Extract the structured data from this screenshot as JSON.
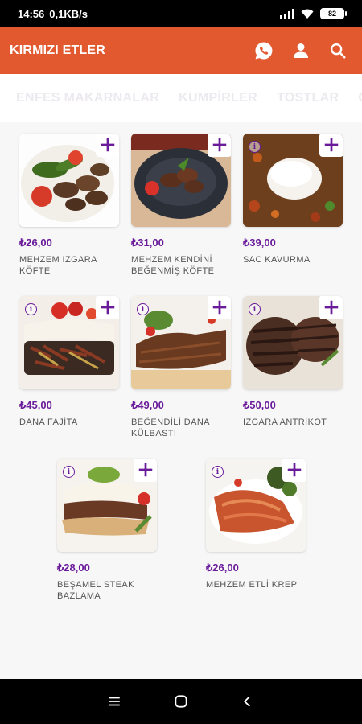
{
  "status_bar": {
    "time": "14:56",
    "network_speed": "0,1KB/s",
    "battery": "82"
  },
  "app_bar": {
    "title": "KIRMIZI ETLER",
    "icons": [
      "whatsapp-icon",
      "user-icon",
      "search-icon"
    ],
    "color": "#e2582f"
  },
  "tabs": [
    {
      "label": "ENFES MAKARNALAR"
    },
    {
      "label": "KUMPİRLER"
    },
    {
      "label": "TOSTLAR"
    },
    {
      "label": "GÖ"
    }
  ],
  "accent_color": "#6a1b9a",
  "products": [
    {
      "price": "₺26,00",
      "name": "MEHZEM IZGARA KÖFTE",
      "has_info": false
    },
    {
      "price": "₺31,00",
      "name": "MEHZEM KENDİNİ BEĞENMİŞ KÖFTE",
      "has_info": false
    },
    {
      "price": "₺39,00",
      "name": "SAC KAVURMA",
      "has_info": true
    },
    {
      "price": "₺45,00",
      "name": "DANA FAJİTA",
      "has_info": true
    },
    {
      "price": "₺49,00",
      "name": "BEĞENDİLİ DANA KÜLBASTI",
      "has_info": true
    },
    {
      "price": "₺50,00",
      "name": "IZGARA ANTRİKOT",
      "has_info": true
    },
    {
      "price": "₺28,00",
      "name": "BEŞAMEL STEAK BAZLAMA",
      "has_info": true
    },
    {
      "price": "₺26,00",
      "name": "MEHZEM ETLİ KREP",
      "has_info": true
    }
  ]
}
